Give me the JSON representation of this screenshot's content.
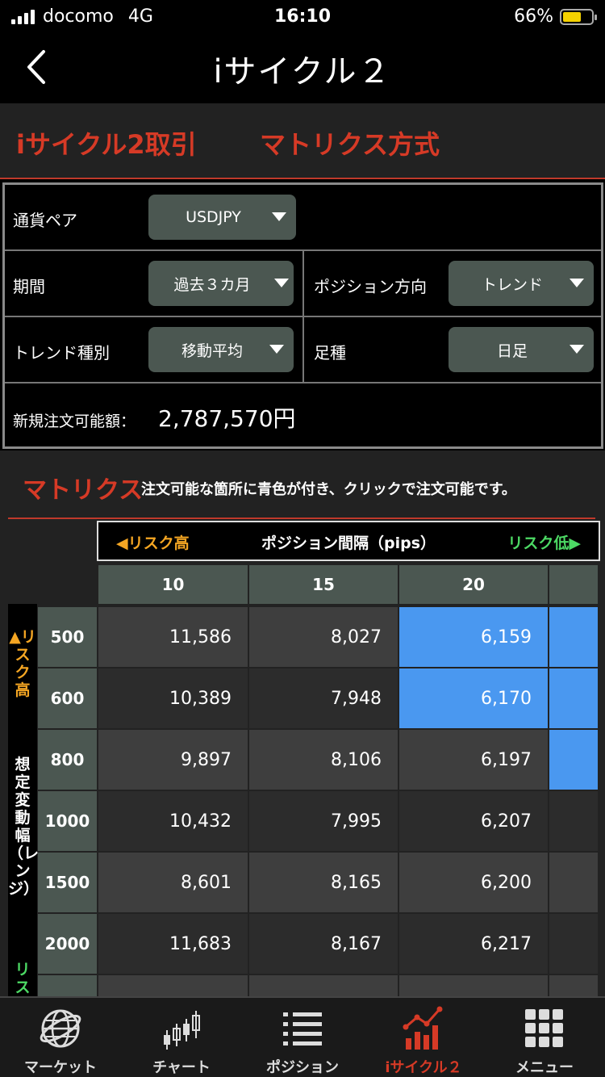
{
  "status_bar": {
    "carrier": "docomo",
    "network": "4G",
    "time": "16:10",
    "battery": "66%"
  },
  "nav": {
    "title": "iサイクル２"
  },
  "header": {
    "tab_trade": "iサイクル2取引",
    "tab_matrix": "マトリクス方式"
  },
  "settings": {
    "pair_label": "通貨ペア",
    "pair_value": "USDJPY",
    "period_label": "期間",
    "period_value": "過去３カ月",
    "direction_label": "ポジション方向",
    "direction_value": "トレンド",
    "trend_type_label": "トレンド種別",
    "trend_type_value": "移動平均",
    "candle_label": "足種",
    "candle_value": "日足",
    "amount_label": "新規注文可能額：",
    "amount_value": "2,787,570円"
  },
  "matrix": {
    "title": "マトリクス",
    "note": "注文可能な箇所に青色が付き、クリックで注文可能です。",
    "risk_high_left": "◀リスク高",
    "pips_label": "ポジション間隔（pips）",
    "risk_low_right": "リスク低▶",
    "columns": [
      "10",
      "15",
      "20"
    ],
    "side_risk_high": "▲リスク高",
    "side_range": "想定変動幅（レンジ）",
    "side_risk_low": "リス",
    "rows": [
      {
        "range": "500",
        "values": [
          "11,586",
          "8,027",
          "6,159"
        ]
      },
      {
        "range": "600",
        "values": [
          "10,389",
          "7,948",
          "6,170"
        ]
      },
      {
        "range": "800",
        "values": [
          "9,897",
          "8,106",
          "6,197"
        ]
      },
      {
        "range": "1000",
        "values": [
          "10,432",
          "7,995",
          "6,207"
        ]
      },
      {
        "range": "1500",
        "values": [
          "8,601",
          "8,165",
          "6,200"
        ]
      },
      {
        "range": "2000",
        "values": [
          "11,683",
          "8,167",
          "6,217"
        ]
      }
    ]
  },
  "tabs": [
    "マーケット",
    "チャート",
    "ポジション",
    "iサイクル２",
    "メニュー"
  ],
  "colors": {
    "accent_red": "#d63a26",
    "available_blue": "#4a98f0",
    "risk_high": "#f5a623",
    "risk_low": "#4cd964"
  }
}
